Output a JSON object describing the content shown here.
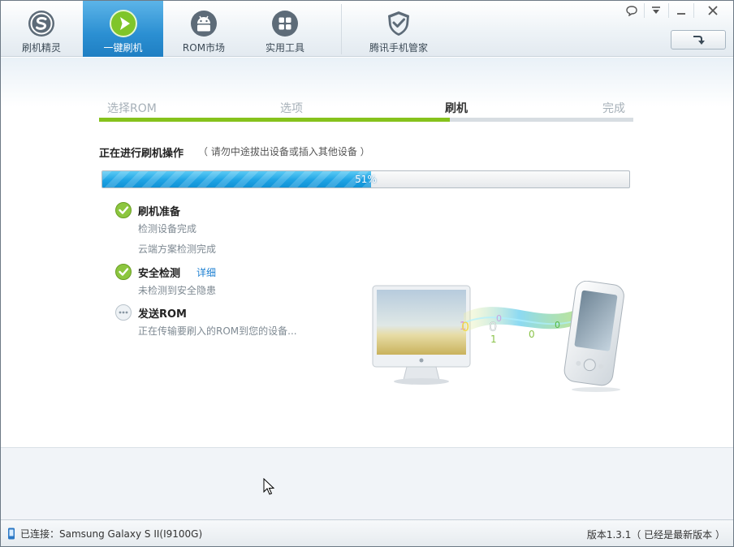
{
  "nav": {
    "tabs": [
      {
        "label": "刷机精灵",
        "icon": "shuaji-logo-icon"
      },
      {
        "label": "一键刷机",
        "icon": "play-arrow-icon",
        "active": true
      },
      {
        "label": "ROM市场",
        "icon": "android-robot-icon"
      },
      {
        "label": "实用工具",
        "icon": "grid-tools-icon"
      },
      {
        "label": "腾讯手机管家",
        "icon": "shield-check-icon"
      }
    ]
  },
  "window_controls": [
    "feedback-bubble-icon",
    "menu-dropdown-icon",
    "minimize-icon",
    "close-icon"
  ],
  "update_button_icon": "arrow-down-right-icon",
  "steps": {
    "items": [
      "选择ROM",
      "选项",
      "刷机",
      "完成"
    ],
    "current_index": 2
  },
  "operation": {
    "title": "正在进行刷机操作",
    "subtitle": "（ 请勿中途拔出设备或插入其他设备 ）"
  },
  "progress": {
    "value": 51,
    "text": "51%"
  },
  "tasks": [
    {
      "status": "done",
      "name": "刷机准备",
      "link": "",
      "lines": [
        "检测设备完成",
        "云端方案检测完成"
      ]
    },
    {
      "status": "done",
      "name": "安全检测",
      "link": "详细",
      "lines": [
        "未检测到安全隐患"
      ]
    },
    {
      "status": "pending",
      "name": "发送ROM",
      "link": "",
      "lines": [
        "正在传输要刷入的ROM到您的设备..."
      ]
    }
  ],
  "status_bar": {
    "connection": "已连接：Samsung Galaxy S II(I9100G)",
    "version": "版本1.3.1（ 已经是最新版本 ）"
  },
  "colors": {
    "accent_blue": "#2b8fd2",
    "step_green": "#86c21c",
    "progress_blue": "#1ea3e4",
    "link_blue": "#1c7fd1"
  }
}
